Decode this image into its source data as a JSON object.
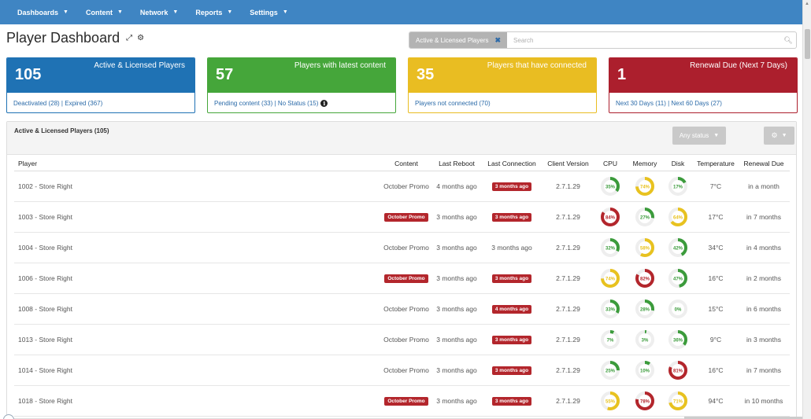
{
  "nav": [
    {
      "label": "Dashboards"
    },
    {
      "label": "Content"
    },
    {
      "label": "Network"
    },
    {
      "label": "Reports"
    },
    {
      "label": "Settings"
    }
  ],
  "page_title": "Player Dashboard",
  "filter": {
    "chip_label": "Active & Licensed Players",
    "search_placeholder": "Search"
  },
  "cards": [
    {
      "count": "105",
      "label": "Active & Licensed Players",
      "link1": "Deactivated (28)",
      "sep": " | ",
      "link2": "Expired (367)"
    },
    {
      "count": "57",
      "label": "Players with latest content",
      "link1": "Pending content (33)",
      "sep": " | ",
      "link2": "No Status (15)"
    },
    {
      "count": "35",
      "label": "Players that have connected",
      "link1": "Players not connected (70)",
      "sep": "",
      "link2": ""
    },
    {
      "count": "1",
      "label": "Renewal Due (Next 7 Days)",
      "link1": "Next 30 Days (11)",
      "sep": " | ",
      "link2": "Next 60 Days (27)"
    }
  ],
  "panel": {
    "title": "Active & Licensed Players (105)",
    "status_label": "Any status"
  },
  "columns": [
    "Player",
    "Content",
    "Last Reboot",
    "Last Connection",
    "Client Version",
    "CPU",
    "Memory",
    "Disk",
    "Temperature",
    "Renewal Due"
  ],
  "colors": {
    "green": "#3b9b3b",
    "yellow": "#e8c21f",
    "red": "#b3262c",
    "track": "#eeeeee"
  },
  "rows": [
    {
      "player": "1002 - Store Right",
      "content": "October Promo",
      "content_badge": false,
      "reboot": "4 months ago",
      "connection": "3 months ago",
      "connection_badge": true,
      "version": "2.7.1.29",
      "cpu": 35,
      "memory": 74,
      "disk": 17,
      "temp": "7°C",
      "renewal": "in a month"
    },
    {
      "player": "1003 - Store Right",
      "content": "October Promo",
      "content_badge": true,
      "reboot": "3 months ago",
      "connection": "3 months ago",
      "connection_badge": true,
      "version": "2.7.1.29",
      "cpu": 84,
      "memory": 27,
      "disk": 64,
      "temp": "17°C",
      "renewal": "in 7 months"
    },
    {
      "player": "1004 - Store Right",
      "content": "October Promo",
      "content_badge": false,
      "reboot": "3 months ago",
      "connection": "3 months ago",
      "connection_badge": false,
      "version": "2.7.1.29",
      "cpu": 32,
      "memory": 58,
      "disk": 42,
      "temp": "34°C",
      "renewal": "in 4 months"
    },
    {
      "player": "1006 - Store Right",
      "content": "October Promo",
      "content_badge": true,
      "reboot": "3 months ago",
      "connection": "3 months ago",
      "connection_badge": true,
      "version": "2.7.1.29",
      "cpu": 74,
      "memory": 82,
      "disk": 47,
      "temp": "16°C",
      "renewal": "in 2 months"
    },
    {
      "player": "1008 - Store Right",
      "content": "October Promo",
      "content_badge": false,
      "reboot": "3 months ago",
      "connection": "4 months ago",
      "connection_badge": true,
      "version": "2.7.1.29",
      "cpu": 33,
      "memory": 28,
      "disk": 0,
      "temp": "15°C",
      "renewal": "in 6 months"
    },
    {
      "player": "1013 - Store Right",
      "content": "October Promo",
      "content_badge": false,
      "reboot": "3 months ago",
      "connection": "3 months ago",
      "connection_badge": true,
      "version": "2.7.1.29",
      "cpu": 7,
      "memory": 3,
      "disk": 36,
      "temp": "9°C",
      "renewal": "in 3 months"
    },
    {
      "player": "1014 - Store Right",
      "content": "October Promo",
      "content_badge": false,
      "reboot": "3 months ago",
      "connection": "3 months ago",
      "connection_badge": true,
      "version": "2.7.1.29",
      "cpu": 25,
      "memory": 10,
      "disk": 81,
      "temp": "16°C",
      "renewal": "in 7 months"
    },
    {
      "player": "1018 - Store Right",
      "content": "October Promo",
      "content_badge": true,
      "reboot": "3 months ago",
      "connection": "3 months ago",
      "connection_badge": true,
      "version": "2.7.1.29",
      "cpu": 55,
      "memory": 78,
      "disk": 71,
      "temp": "94°C",
      "renewal": "in 10 months"
    }
  ]
}
